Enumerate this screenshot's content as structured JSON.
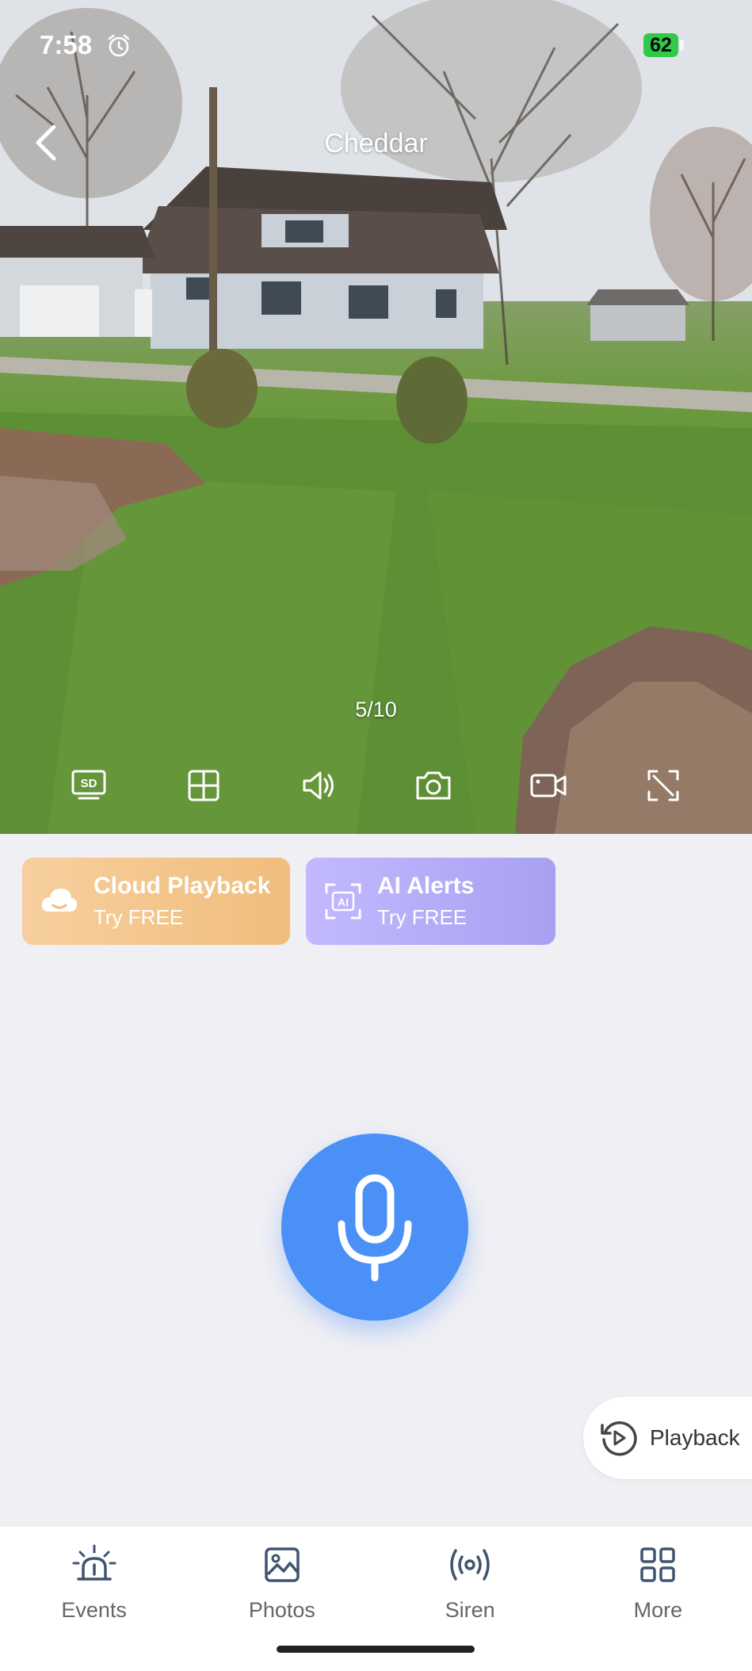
{
  "status_bar": {
    "time": "7:58",
    "battery": "62"
  },
  "header": {
    "title": "Cheddar"
  },
  "feed": {
    "page_counter": "5/10"
  },
  "controls": [
    {
      "name": "sd-quality",
      "icon": "sd-icon"
    },
    {
      "name": "grid-view",
      "icon": "grid-icon"
    },
    {
      "name": "speaker",
      "icon": "speaker-icon"
    },
    {
      "name": "snapshot",
      "icon": "camera-icon"
    },
    {
      "name": "record",
      "icon": "video-icon"
    },
    {
      "name": "fullscreen",
      "icon": "fullscreen-icon"
    }
  ],
  "promos": {
    "cloud": {
      "title": "Cloud Playback",
      "subtitle": "Try FREE",
      "color": "#f2c183"
    },
    "ai": {
      "title": "AI Alerts",
      "subtitle": "Try FREE",
      "color": "#b3abf8"
    }
  },
  "mic": {
    "color": "#4a90f7"
  },
  "playback": {
    "label": "Playback"
  },
  "tabs": [
    {
      "label": "Events",
      "icon": "siren-light-icon"
    },
    {
      "label": "Photos",
      "icon": "photo-icon"
    },
    {
      "label": "Siren",
      "icon": "broadcast-icon"
    },
    {
      "label": "More",
      "icon": "grid-more-icon"
    }
  ]
}
